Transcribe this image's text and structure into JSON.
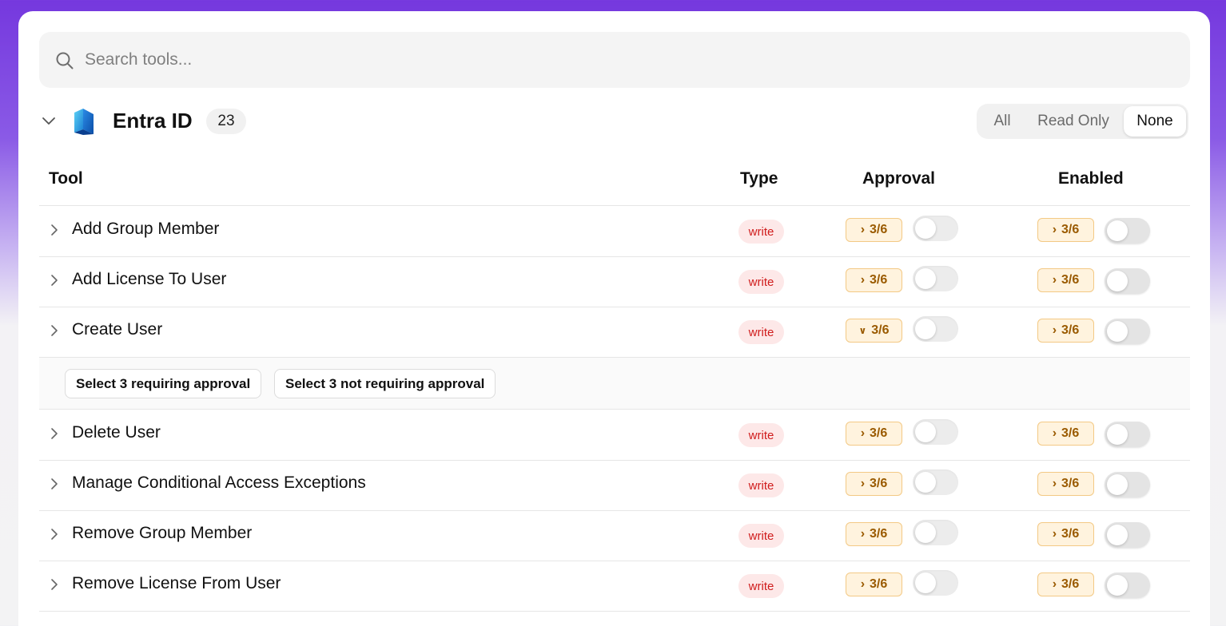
{
  "search": {
    "placeholder": "Search tools..."
  },
  "group": {
    "title": "Entra ID",
    "count": "23",
    "filters": [
      {
        "label": "All",
        "active": false
      },
      {
        "label": "Read Only",
        "active": false
      },
      {
        "label": "None",
        "active": true
      }
    ]
  },
  "table": {
    "headers": {
      "tool": "Tool",
      "type": "Type",
      "approval": "Approval",
      "enabled": "Enabled"
    },
    "rows": [
      {
        "name": "Add Group Member",
        "type": "write",
        "approval_count": "3/6",
        "enabled_count": "3/6",
        "expanded": false
      },
      {
        "name": "Add License To User",
        "type": "write",
        "approval_count": "3/6",
        "enabled_count": "3/6",
        "expanded": false
      },
      {
        "name": "Create User",
        "type": "write",
        "approval_count": "3/6",
        "enabled_count": "3/6",
        "expanded": true
      },
      {
        "name": "Delete User",
        "type": "write",
        "approval_count": "3/6",
        "enabled_count": "3/6",
        "expanded": false
      },
      {
        "name": "Manage Conditional Access Exceptions",
        "type": "write",
        "approval_count": "3/6",
        "enabled_count": "3/6",
        "expanded": false
      },
      {
        "name": "Remove Group Member",
        "type": "write",
        "approval_count": "3/6",
        "enabled_count": "3/6",
        "expanded": false
      },
      {
        "name": "Remove License From User",
        "type": "write",
        "approval_count": "3/6",
        "enabled_count": "3/6",
        "expanded": false
      }
    ],
    "expanded_actions": {
      "select_requiring": "Select 3 requiring approval",
      "select_not_requiring": "Select 3 not requiring approval"
    }
  },
  "colors": {
    "background_top": "#7538de",
    "type_badge_text": "#d01c1c",
    "type_badge_bg": "#fde8e8",
    "count_chip_bg": "#fff3de",
    "count_chip_text": "#9a5a00"
  }
}
